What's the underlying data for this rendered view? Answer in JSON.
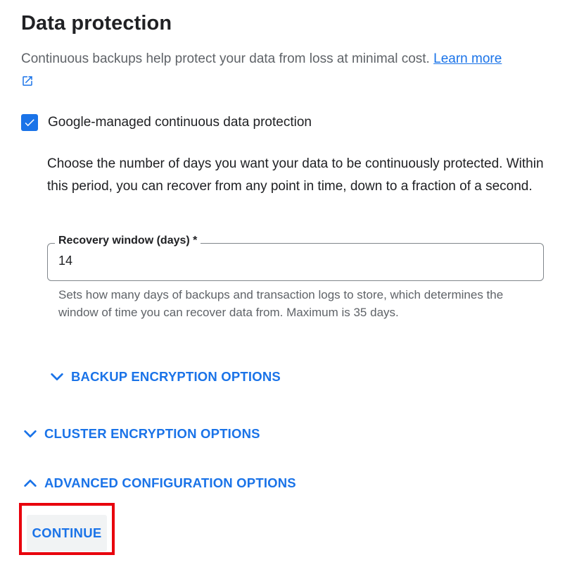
{
  "section": {
    "title": "Data protection",
    "intro_text": "Continuous backups help protect your data from loss at minimal cost.",
    "learn_more_label": "Learn more",
    "external_link_icon": "open-in-new-icon"
  },
  "continuous_protection": {
    "checkbox_label": "Google-managed continuous data protection",
    "checked": true,
    "description": "Choose the number of days you want your data to be continuously protected. Within this period, you can recover from any point in time, down to a fraction of a second.",
    "recovery_window": {
      "label": "Recovery window (days) *",
      "value": "14",
      "helper": "Sets how many days of backups and transaction logs to store, which determines the window of time you can recover data from. Maximum is 35 days."
    }
  },
  "expanders": {
    "backup_encryption": {
      "label": "BACKUP ENCRYPTION OPTIONS",
      "icon": "chevron-down-icon"
    },
    "cluster_encryption": {
      "label": "CLUSTER ENCRYPTION OPTIONS",
      "icon": "chevron-down-icon"
    },
    "advanced_configuration": {
      "label": "ADVANCED CONFIGURATION OPTIONS",
      "icon": "chevron-up-icon"
    }
  },
  "actions": {
    "continue_label": "CONTINUE"
  },
  "colors": {
    "accent": "#1a73e8",
    "highlight_outline": "#e8000c",
    "button_bg": "#f1f3f4"
  }
}
